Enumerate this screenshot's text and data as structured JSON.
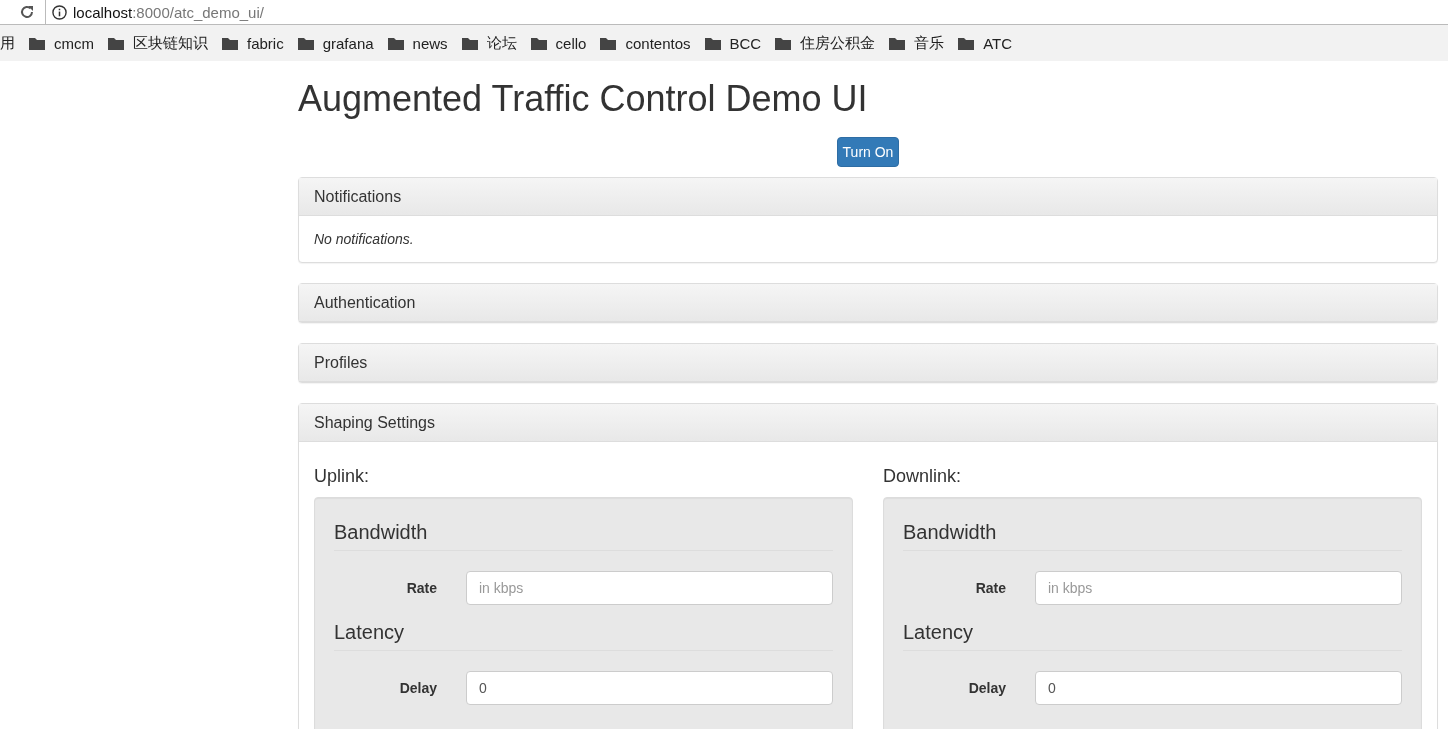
{
  "browser": {
    "address_host": "localhost",
    "address_path": ":8000/atc_demo_ui/"
  },
  "bookmarks": [
    {
      "label": "用",
      "kind": "text"
    },
    {
      "label": "cmcm",
      "kind": "folder"
    },
    {
      "label": "区块链知识",
      "kind": "folder"
    },
    {
      "label": "fabric",
      "kind": "folder"
    },
    {
      "label": "grafana",
      "kind": "folder"
    },
    {
      "label": "news",
      "kind": "folder"
    },
    {
      "label": "论坛",
      "kind": "folder"
    },
    {
      "label": "cello",
      "kind": "folder"
    },
    {
      "label": "contentos",
      "kind": "folder"
    },
    {
      "label": "BCC",
      "kind": "folder"
    },
    {
      "label": "住房公积金",
      "kind": "folder"
    },
    {
      "label": "音乐",
      "kind": "folder"
    },
    {
      "label": "ATC",
      "kind": "folder"
    }
  ],
  "page": {
    "title": "Augmented Traffic Control Demo UI",
    "toggle_button": "Turn On",
    "panels": [
      {
        "title": "Notifications",
        "body": "No notifications."
      },
      {
        "title": "Authentication"
      },
      {
        "title": "Profiles"
      }
    ],
    "shaping": {
      "title": "Shaping Settings",
      "directions": [
        {
          "label": "Uplink:",
          "sections": [
            {
              "title": "Bandwidth",
              "fields": [
                {
                  "label": "Rate",
                  "placeholder": "in kbps"
                }
              ]
            },
            {
              "title": "Latency",
              "fields": [
                {
                  "label": "Delay",
                  "value": "0"
                }
              ]
            }
          ]
        },
        {
          "label": "Downlink:",
          "sections": [
            {
              "title": "Bandwidth",
              "fields": [
                {
                  "label": "Rate",
                  "placeholder": "in kbps"
                }
              ]
            },
            {
              "title": "Latency",
              "fields": [
                {
                  "label": "Delay",
                  "value": "0"
                }
              ]
            }
          ]
        }
      ]
    }
  }
}
